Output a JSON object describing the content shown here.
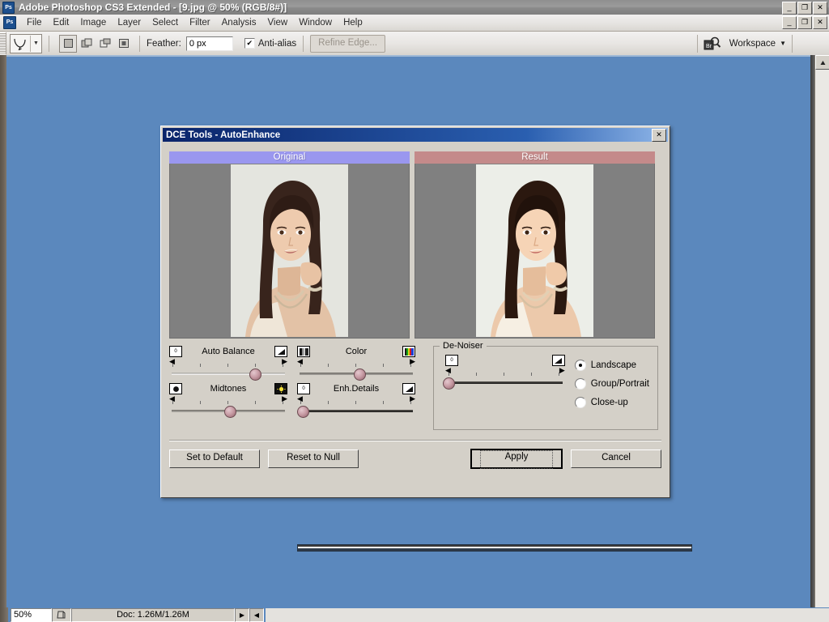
{
  "window": {
    "title": "Adobe Photoshop CS3 Extended - [9.jpg @ 50% (RGB/8#)]",
    "app_badge": "Ps",
    "minimize": "_",
    "maximize": "❐",
    "close": "✕",
    "doc_minimize": "_",
    "doc_restore": "❐",
    "doc_close": "✕"
  },
  "menu": {
    "items": [
      {
        "label": "File"
      },
      {
        "label": "Edit"
      },
      {
        "label": "Image"
      },
      {
        "label": "Layer"
      },
      {
        "label": "Select"
      },
      {
        "label": "Filter"
      },
      {
        "label": "Analysis"
      },
      {
        "label": "View"
      },
      {
        "label": "Window"
      },
      {
        "label": "Help"
      }
    ]
  },
  "options_bar": {
    "tool_name": "lasso-tool",
    "tool_dropdown_arrow": "▼",
    "selection_modes": [
      "new-selection",
      "add-to-selection",
      "subtract-from-selection",
      "intersect-with-selection"
    ],
    "feather_label": "Feather:",
    "feather_value": "0 px",
    "feather_placeholder": "0 px",
    "antialias_label": "Anti-alias",
    "antialias_checked": "✔",
    "refine_edge_label": "Refine Edge...",
    "workspace_label": "Workspace",
    "workspace_arrow": "▼",
    "bridge_badge": "Br"
  },
  "status_bar": {
    "zoom": "50%",
    "doc_info": "Doc: 1.26M/1.26M",
    "arrow": "▶",
    "left_arrow": "◀"
  },
  "dialog": {
    "title": "DCE Tools - AutoEnhance",
    "close_label": "✕",
    "previews": [
      {
        "name": "original",
        "label": "Original"
      },
      {
        "name": "result",
        "label": "Result"
      }
    ],
    "sliders": [
      {
        "id": "auto-balance",
        "label": "Auto Balance",
        "left_icon": "zero-icon",
        "left_icon_glyph": "0",
        "right_icon": "gradient-ramp-icon",
        "right_icon_glyph": "◢",
        "value_percent": 72,
        "track_style": "light",
        "arrow_left": "◀",
        "arrow_right": "▶"
      },
      {
        "id": "color",
        "label": "Color",
        "left_icon": "grayscale-bars-icon",
        "left_icon_glyph": "▓",
        "right_icon": "color-spectrum-icon",
        "right_icon_glyph": "▓",
        "value_percent": 52,
        "track_style": "gray",
        "arrow_left": "◀",
        "arrow_right": "▶"
      },
      {
        "id": "midtones",
        "label": "Midtones",
        "left_icon": "dark-circle-icon",
        "left_icon_glyph": "●",
        "right_icon": "sun-icon",
        "right_icon_glyph": "☀",
        "value_percent": 50,
        "track_style": "gray",
        "arrow_left": "◀",
        "arrow_right": "▶"
      },
      {
        "id": "enh-details",
        "label": "Enh.Details",
        "left_icon": "zero-icon",
        "left_icon_glyph": "0",
        "right_icon": "gradient-ramp-icon",
        "right_icon_glyph": "◢",
        "value_percent": 3,
        "track_style": "dark",
        "arrow_left": "◀",
        "arrow_right": "▶"
      }
    ],
    "denoiser": {
      "title": "De-Noiser",
      "slider": {
        "id": "denoise-amount",
        "left_icon": "zero-icon",
        "left_icon_glyph": "0",
        "right_icon": "gradient-ramp-icon",
        "right_icon_glyph": "◢",
        "value_percent": 1,
        "track_style": "dark",
        "arrow_left": "◀",
        "arrow_right": "▶"
      },
      "options": [
        {
          "label": "Landscape",
          "selected": true
        },
        {
          "label": "Group/Portrait",
          "selected": false
        },
        {
          "label": "Close-up",
          "selected": false
        }
      ]
    },
    "buttons": {
      "set_to_default": "Set to Default",
      "reset_to_null": "Reset to Null",
      "apply": "Apply",
      "cancel": "Cancel"
    }
  },
  "colors": {
    "desktop": "#5b88bd",
    "dialog_face": "#d4d0c8",
    "dialog_title_start": "#0a246a",
    "original_header": "#9a97ef",
    "result_header": "#c48a8a",
    "preview_bg": "#808080"
  }
}
